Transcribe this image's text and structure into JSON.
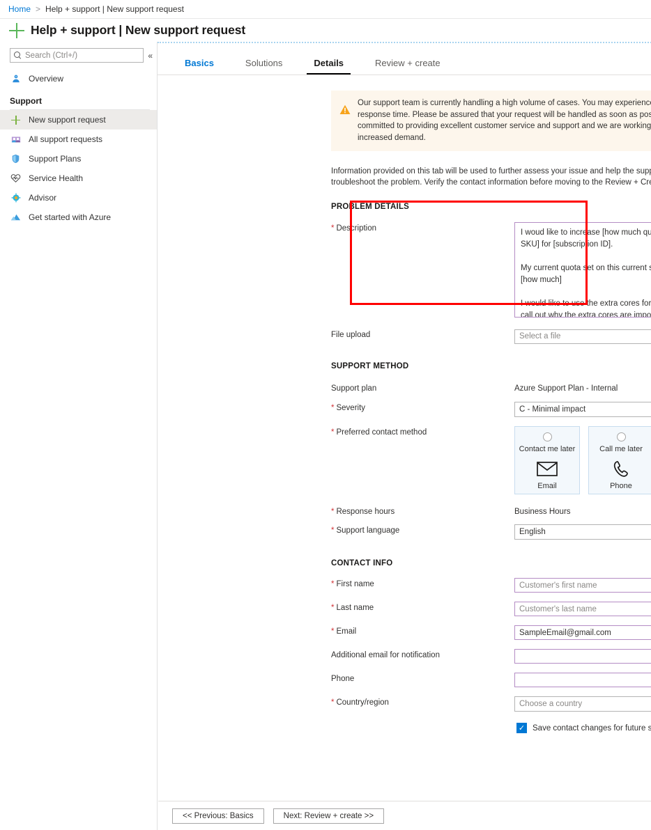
{
  "breadcrumb": {
    "home": "Home",
    "separator": ">",
    "current": "Help + support | New support request"
  },
  "header": {
    "title": "Help + support | New support request",
    "plus_icon": "plus-icon"
  },
  "sidebar": {
    "search": {
      "placeholder": "Search (Ctrl+/)",
      "value": "",
      "icon": "search-icon"
    },
    "collapse": "«",
    "overview": {
      "label": "Overview",
      "icon": "user-badge-icon"
    },
    "group_title": "Support",
    "items": [
      {
        "label": "New support request",
        "icon": "plus-icon",
        "selected": true
      },
      {
        "label": "All support requests",
        "icon": "people-icon",
        "selected": false
      },
      {
        "label": "Support Plans",
        "icon": "shield-icon",
        "selected": false
      },
      {
        "label": "Service Health",
        "icon": "heart-pulse-icon",
        "selected": false
      },
      {
        "label": "Advisor",
        "icon": "advisor-icon",
        "selected": false
      },
      {
        "label": "Get started with Azure",
        "icon": "azure-cloud-icon",
        "selected": false
      }
    ]
  },
  "tabs": [
    {
      "label": "Basics",
      "state": "link"
    },
    {
      "label": "Solutions",
      "state": "normal"
    },
    {
      "label": "Details",
      "state": "active"
    },
    {
      "label": "Review + create",
      "state": "normal"
    }
  ],
  "banner": {
    "icon": "warning-icon",
    "text": "Our support team is currently handling a high volume of cases. You may experience longer than expected response time. Please be assured that your request will be handled as soon as possible. We are committed to providing excellent customer service and support and we are working hard to meet increased demand."
  },
  "intro": "Information provided on this tab will be used to further assess your issue and help the support engineer troubleshoot the problem. Verify the contact information before moving to the Review + Create.",
  "problem_details": {
    "heading": "PROBLEM DETAILS",
    "description": {
      "label": "Description",
      "required": true,
      "value": "I woud like to increase [how much quota] on [which SKU] for [subscription ID].\n\nMy current quota set on this current subscription is [how much]\n\nI would like to use the extra cores for [use purpose to call out why the extra cores are important]",
      "scrollbar_down": "▼",
      "valid_check": "✔"
    },
    "file_upload": {
      "label": "File upload",
      "required": false,
      "placeholder": "Select a file",
      "value": "",
      "button_icon": "folder-open-icon"
    }
  },
  "support_method": {
    "heading": "SUPPORT METHOD",
    "support_plan": {
      "label": "Support plan",
      "required": false,
      "value": "Azure Support Plan - Internal"
    },
    "severity": {
      "label": "Severity",
      "required": true,
      "value": "C - Minimal impact"
    },
    "contact_method": {
      "label": "Preferred contact method",
      "required": true,
      "options": [
        {
          "top": "Contact me later",
          "bottom": "Email",
          "icon": "envelope-icon",
          "selected": false
        },
        {
          "top": "Call me later",
          "bottom": "Phone",
          "icon": "phone-icon",
          "selected": false
        }
      ]
    },
    "response_hours": {
      "label": "Response hours",
      "required": true,
      "value": "Business Hours"
    },
    "support_language": {
      "label": "Support language",
      "required": true,
      "value": "English"
    }
  },
  "contact_info": {
    "heading": "CONTACT INFO",
    "fields": [
      {
        "label": "First name",
        "required": true,
        "value": "",
        "placeholder": "Customer's first name",
        "validated": true,
        "check": "✓"
      },
      {
        "label": "Last name",
        "required": true,
        "value": "",
        "placeholder": "Customer's last name",
        "validated": true,
        "check": "✓"
      },
      {
        "label": "Email",
        "required": true,
        "value": "SampleEmail@gmail.com",
        "placeholder": "",
        "validated": true,
        "check": "✓"
      },
      {
        "label": "Additional email for notification",
        "required": false,
        "value": "",
        "placeholder": "",
        "validated": true,
        "check": "✓"
      },
      {
        "label": "Phone",
        "required": false,
        "value": "",
        "placeholder": "",
        "validated": true,
        "check": "✓"
      }
    ],
    "country": {
      "label": "Country/region",
      "required": true,
      "placeholder": "Choose a country",
      "value": ""
    },
    "save_contact": {
      "label": "Save contact changes for future support requests.",
      "checked": true,
      "check": "✓"
    }
  },
  "footer": {
    "previous": "<< Previous: Basics",
    "next": "Next: Review + create >>"
  },
  "colors": {
    "accent": "#0078d4",
    "link": "#0078d4",
    "required": "#d13438",
    "warning_bg": "#fdf6ec",
    "warning_icon": "#f7a31a",
    "validated_border": "#b48cc4",
    "check_green": "#5aa02c",
    "annotation": "#ff0000",
    "plus_green": "#5ab75a"
  }
}
